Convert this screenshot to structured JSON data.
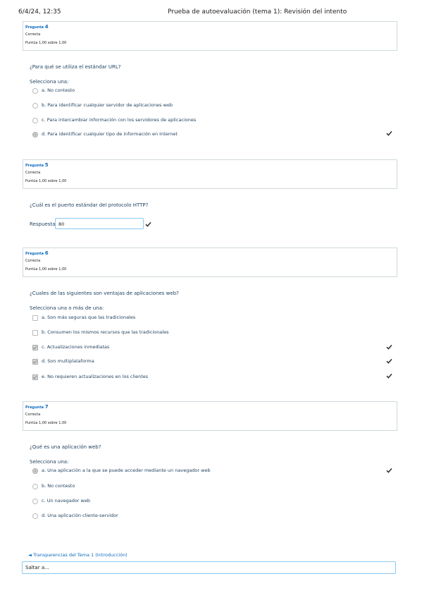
{
  "header": {
    "date": "6/4/24, 12:35",
    "title": "Prueba de autoevaluación (tema 1): Revisión del intento"
  },
  "questions": [
    {
      "number_label": "Pregunta",
      "number": "4",
      "state": "Correcta",
      "grade": "Puntúa 1,00 sobre 1,00",
      "text": "¿Para qué se utiliza el estándar URL?",
      "prompt": "Selecciona una:",
      "options": [
        {
          "label": "a. No contesto",
          "selected": false,
          "correct": false
        },
        {
          "label": "b. Para identificar cualquier servidor de aplicaciones web",
          "selected": false,
          "correct": false
        },
        {
          "label": "c. Para intercambiar información con los servidores de aplicaciones",
          "selected": false,
          "correct": false
        },
        {
          "label": "d. Para identificar cualquier tipo de información en Internet",
          "selected": true,
          "correct": true
        }
      ]
    },
    {
      "number_label": "Pregunta",
      "number": "5",
      "state": "Correcta",
      "grade": "Puntúa 1,00 sobre 1,00",
      "text": "¿Cuál es el puerto estándar del protocolo HTTP?",
      "answer_label": "Respuesta:",
      "answer_value": "80",
      "correct": true
    },
    {
      "number_label": "Pregunta",
      "number": "6",
      "state": "Correcta",
      "grade": "Puntúa 1,00 sobre 1,00",
      "text": "¿Cuales de las siguientes son ventajas de aplicaciones web?",
      "prompt": "Selecciona una o más de una:",
      "options": [
        {
          "label": "a. Son más seguras que las tradicionales",
          "selected": false,
          "correct": false
        },
        {
          "label": "b. Consumen los mismos recursos que las tradicionales",
          "selected": false,
          "correct": false
        },
        {
          "label": "c. Actualizaciones inmediatas",
          "selected": true,
          "correct": true
        },
        {
          "label": "d. Son multiplataforma",
          "selected": true,
          "correct": true
        },
        {
          "label": "e. No requieren actualizaciones en los clientes",
          "selected": true,
          "correct": true
        }
      ]
    },
    {
      "number_label": "Pregunta",
      "number": "7",
      "state": "Correcta",
      "grade": "Puntúa 1,00 sobre 1,00",
      "text": "¿Qué es una aplicación web?",
      "prompt": "Selecciona una:",
      "options": [
        {
          "label": "a. Una aplicación a la que se puede acceder mediante un navegador web",
          "selected": true,
          "correct": true
        },
        {
          "label": "b. No contesto",
          "selected": false,
          "correct": false
        },
        {
          "label": "c. Un navegador web",
          "selected": false,
          "correct": false
        },
        {
          "label": "d. Una aplicación cliente-servidor",
          "selected": false,
          "correct": false
        }
      ]
    }
  ],
  "footer": {
    "prev_link": "◄ Transparencias del Tema 1 (Introducción)",
    "jump_placeholder": "Saltar a..."
  },
  "colors": {
    "accent": "#0f6cbf",
    "text": "#1d3f5c",
    "check": "#333333"
  },
  "icons": {
    "correct": "check-icon"
  }
}
